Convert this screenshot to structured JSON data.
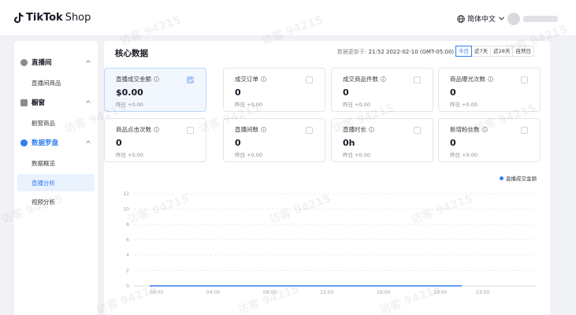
{
  "header": {
    "logo_brand": "TikTok",
    "logo_product": "Shop",
    "language": "简体中文"
  },
  "sidebar": {
    "groups": [
      {
        "label": "直播间",
        "items": [
          {
            "label": "直播间商品"
          }
        ]
      },
      {
        "label": "橱窗",
        "items": [
          {
            "label": "橱窗商品"
          }
        ]
      },
      {
        "label": "数据罗盘",
        "items": [
          {
            "label": "数据概览"
          },
          {
            "label": "直播分析"
          },
          {
            "label": "视频分析"
          }
        ]
      }
    ],
    "active_item": "直播分析"
  },
  "main": {
    "title": "核心数据",
    "update_label": "数据更新于:",
    "update_time": "21:52 2022-02-10 (GMT-05:00)",
    "ranges": [
      "今日",
      "近7天",
      "近28天",
      "自然日"
    ],
    "active_range": "今日",
    "cards": [
      {
        "label": "直播成交金额",
        "value": "$0.00",
        "compare": "昨日 +0.00",
        "checked": true
      },
      {
        "label": "成交订单",
        "value": "0",
        "compare": "昨日 +0.00",
        "checked": false
      },
      {
        "label": "成交商品件数",
        "value": "0",
        "compare": "昨日 +0.00",
        "checked": false
      },
      {
        "label": "商品曝光次数",
        "value": "0",
        "compare": "昨日 +0.00",
        "checked": false
      },
      {
        "label": "商品点击次数",
        "value": "0",
        "compare": "昨日 +0.00",
        "checked": false
      },
      {
        "label": "直播间数",
        "value": "0",
        "compare": "昨日 +0.00",
        "checked": false
      },
      {
        "label": "直播时长",
        "value": "0h",
        "compare": "昨日 +0.00",
        "checked": false
      },
      {
        "label": "新增粉丝数",
        "value": "0",
        "compare": "昨日 +0.00",
        "checked": false
      }
    ],
    "watermark": "访客 94215"
  },
  "colors": {
    "accent": "#2f7ff0",
    "line": "#2f7ff0",
    "grid": "#e6e7ea"
  },
  "chart_data": {
    "type": "line",
    "series": [
      {
        "name": "直播成交金额",
        "x": [
          "00:00",
          "04:00",
          "08:00",
          "12:00",
          "16:00",
          "20:00",
          "22:00"
        ],
        "values": [
          0,
          0,
          0,
          0,
          0,
          0,
          0
        ]
      }
    ],
    "x_ticks": [
      "00:00",
      "04:00",
      "08:00",
      "12:00",
      "16:00",
      "20:00",
      "23:00"
    ],
    "y_ticks": [
      0,
      2,
      4,
      6,
      8,
      10,
      12
    ],
    "ylim": [
      0,
      12
    ],
    "grid": true,
    "legend": "top-right"
  }
}
